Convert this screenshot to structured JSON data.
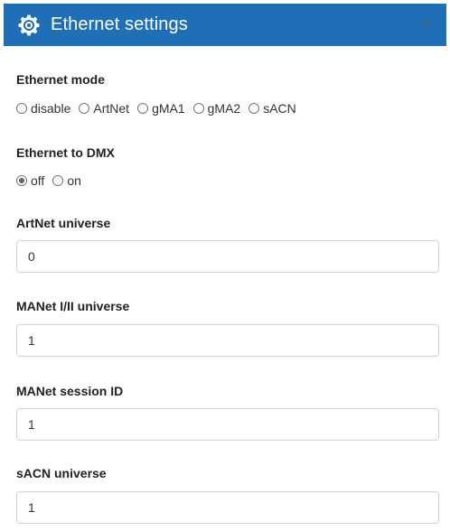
{
  "header": {
    "title": "Ethernet settings",
    "close_glyph": "×",
    "icon": "gear-icon",
    "background": "#1e6fb5"
  },
  "ethernet_mode": {
    "label": "Ethernet mode",
    "options": [
      "disable",
      "ArtNet",
      "gMA1",
      "gMA2",
      "sACN"
    ],
    "selected": null
  },
  "ethernet_to_dmx": {
    "label": "Ethernet to DMX",
    "options": [
      "off",
      "on"
    ],
    "selected": "off"
  },
  "artnet_universe": {
    "label": "ArtNet universe",
    "value": "0"
  },
  "manet_universe": {
    "label": "MANet I/II universe",
    "value": "1"
  },
  "manet_session": {
    "label": "MANet session ID",
    "value": "1"
  },
  "sacn_universe": {
    "label": "sACN universe",
    "value": "1"
  }
}
